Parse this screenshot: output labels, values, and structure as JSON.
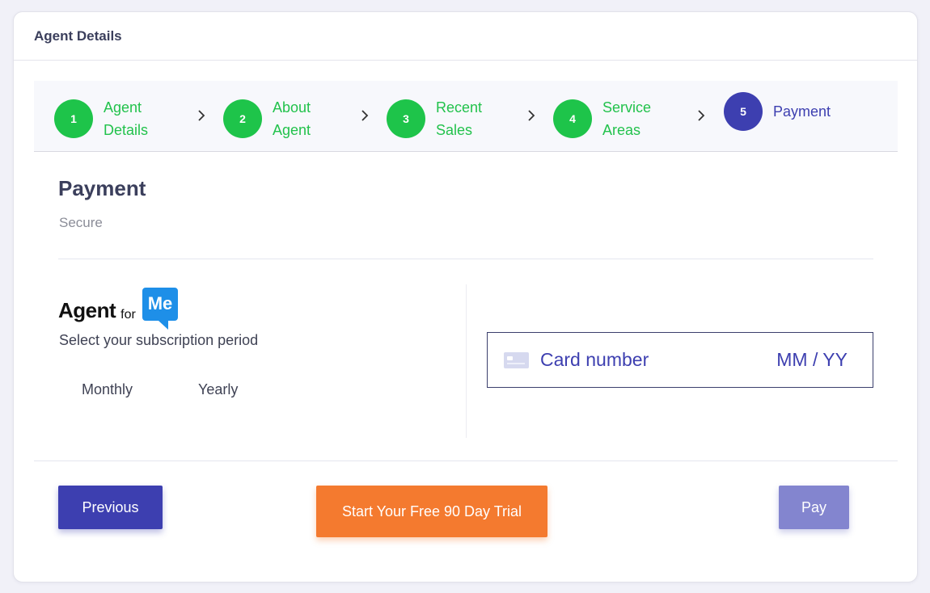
{
  "header": {
    "title": "Agent Details"
  },
  "stepper": {
    "steps": [
      {
        "number": "1",
        "line1": "Agent",
        "line2": "Details",
        "state": "completed"
      },
      {
        "number": "2",
        "line1": "About",
        "line2": "Agent",
        "state": "completed"
      },
      {
        "number": "3",
        "line1": "Recent",
        "line2": "Sales",
        "state": "completed"
      },
      {
        "number": "4",
        "line1": "Service",
        "line2": "Areas",
        "state": "completed"
      },
      {
        "number": "5",
        "line1": "Payment",
        "line2": "",
        "state": "active"
      }
    ],
    "separator_icon": "chevron-right-icon"
  },
  "section": {
    "title": "Payment",
    "subtitle": "Secure"
  },
  "logo": {
    "word1": "Agent",
    "word2": "for",
    "word3": "Me"
  },
  "subscription": {
    "label": "Select your subscription period",
    "options": [
      "Monthly",
      "Yearly"
    ]
  },
  "card_input": {
    "number_placeholder": "Card number",
    "expiry_placeholder": "MM / YY",
    "icon": "credit-card-icon"
  },
  "actions": {
    "previous": "Previous",
    "trial": "Start Your Free 90 Day Trial",
    "pay": "Pay"
  },
  "colors": {
    "step_completed": "#1ec44a",
    "step_active": "#3d3fb0",
    "primary": "#3d3fb0",
    "trial": "#f47a2f",
    "pay_disabled": "#8385cf",
    "logo_blue": "#1e8fe8"
  }
}
